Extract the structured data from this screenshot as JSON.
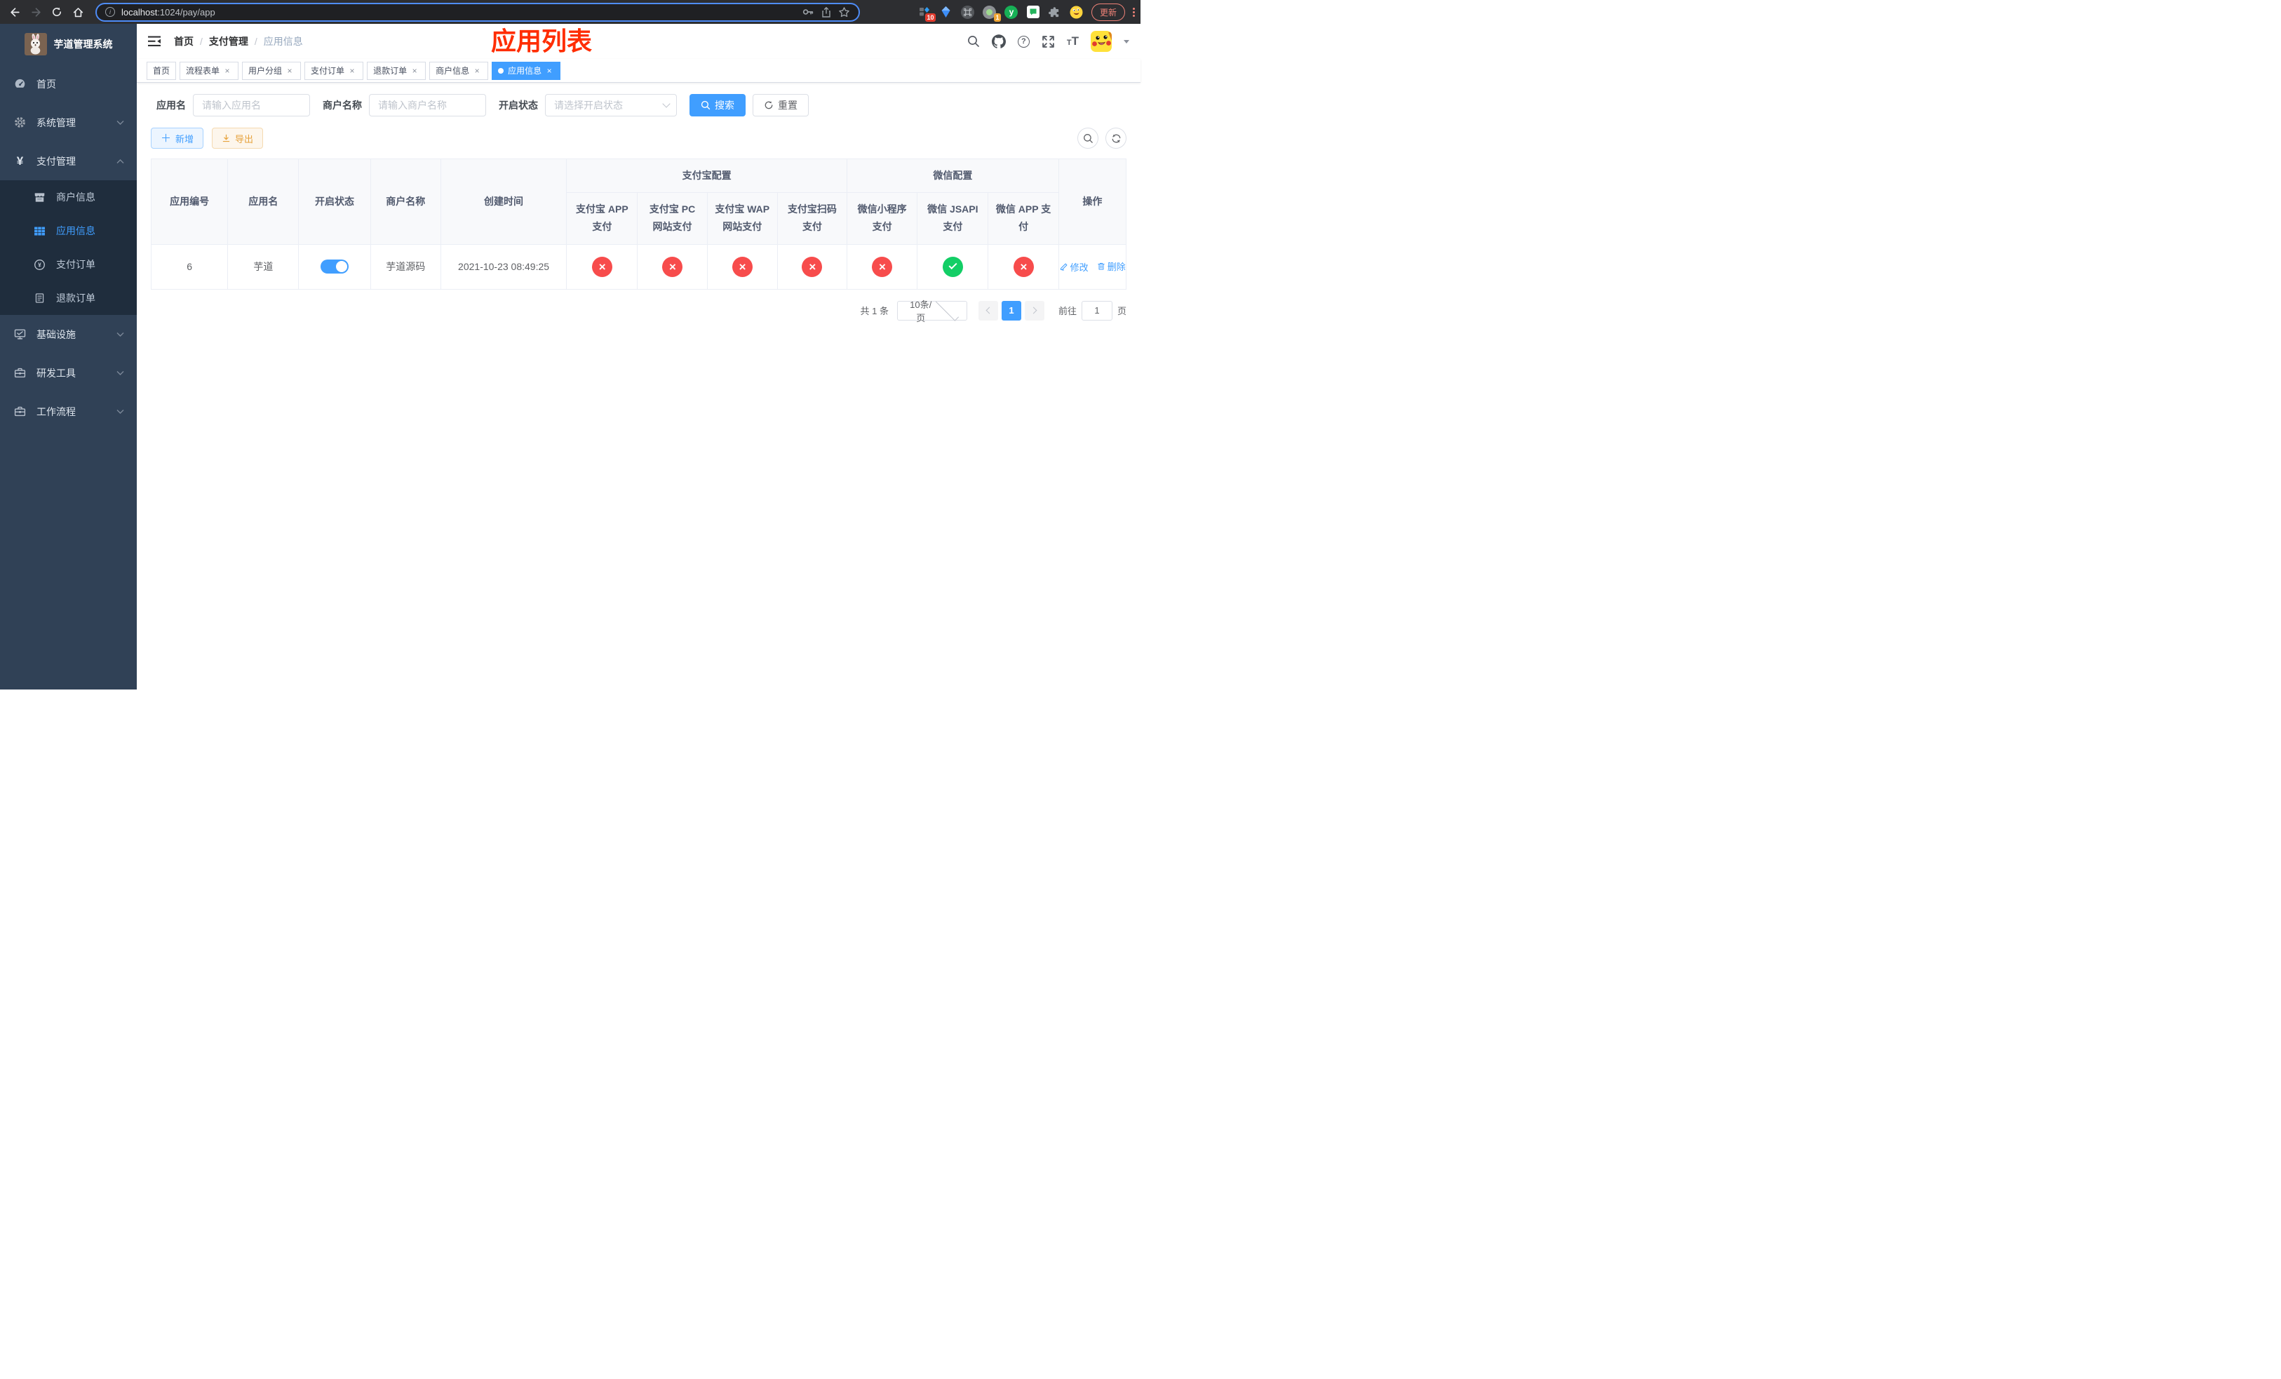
{
  "colors": {
    "accent": "#409eff",
    "danger": "#f74c4c",
    "success": "#13ce66",
    "warning": "#e6a23c",
    "sidebar_bg": "#304156",
    "submenu_bg": "#1f2d3d",
    "annotation_red": "#ff2d00",
    "update_pill": "#ee8277"
  },
  "browser": {
    "url_host": "localhost",
    "url_rest": ":1024/pay/app",
    "ext_badge_a": "10",
    "ext_badge_b": "1",
    "ext_letter": "y",
    "update_label": "更新"
  },
  "sidebar": {
    "title": "芋道管理系统",
    "items": [
      {
        "label": "首页"
      },
      {
        "label": "系统管理"
      },
      {
        "label": "支付管理"
      }
    ],
    "submenu": [
      {
        "label": "商户信息"
      },
      {
        "label": "应用信息"
      },
      {
        "label": "支付订单"
      },
      {
        "label": "退款订单"
      }
    ],
    "items_bottom": [
      {
        "label": "基础设施"
      },
      {
        "label": "研发工具"
      },
      {
        "label": "工作流程"
      }
    ]
  },
  "breadcrumb": {
    "home": "首页",
    "section": "支付管理",
    "current": "应用信息"
  },
  "annotation": "应用列表",
  "tabs": [
    {
      "label": "首页"
    },
    {
      "label": "流程表单"
    },
    {
      "label": "用户分组"
    },
    {
      "label": "支付订单"
    },
    {
      "label": "退款订单"
    },
    {
      "label": "商户信息"
    },
    {
      "label": "应用信息"
    }
  ],
  "filters": {
    "app_name_label": "应用名",
    "app_name_placeholder": "请输入应用名",
    "merchant_label": "商户名称",
    "merchant_placeholder": "请输入商户名称",
    "status_label": "开启状态",
    "status_placeholder": "请选择开启状态",
    "search_label": "搜索",
    "reset_label": "重置"
  },
  "toolbar": {
    "add_label": "新增",
    "export_label": "导出"
  },
  "table": {
    "headers": {
      "app_id": "应用编号",
      "app_name": "应用名",
      "open_status": "开启状态",
      "merchant_name": "商户名称",
      "create_time": "创建时间",
      "alipay_group": "支付宝配置",
      "wechat_group": "微信配置",
      "alipay_app": "支付宝 APP 支付",
      "alipay_pc": "支付宝 PC 网站支付",
      "alipay_wap": "支付宝 WAP 网站支付",
      "alipay_qr": "支付宝扫码支付",
      "wx_mini": "微信小程序支付",
      "wx_jsapi": "微信 JSAPI 支付",
      "wx_app": "微信 APP 支付",
      "actions": "操作"
    },
    "row": {
      "app_id": "6",
      "app_name": "芋道",
      "enabled": true,
      "merchant_name": "芋道源码",
      "create_time": "2021-10-23 08:49:25",
      "channels": {
        "alipay_app": false,
        "alipay_pc": false,
        "alipay_wap": false,
        "alipay_qr": false,
        "wx_mini": false,
        "wx_jsapi": true,
        "wx_app": false
      }
    },
    "actions": {
      "edit_label": "修改",
      "delete_label": "删除"
    }
  },
  "pagination": {
    "total": "共 1 条",
    "page_size": "10条/页",
    "current_page": "1",
    "goto_label": "前往",
    "page_unit": "页",
    "goto_value": "1"
  }
}
